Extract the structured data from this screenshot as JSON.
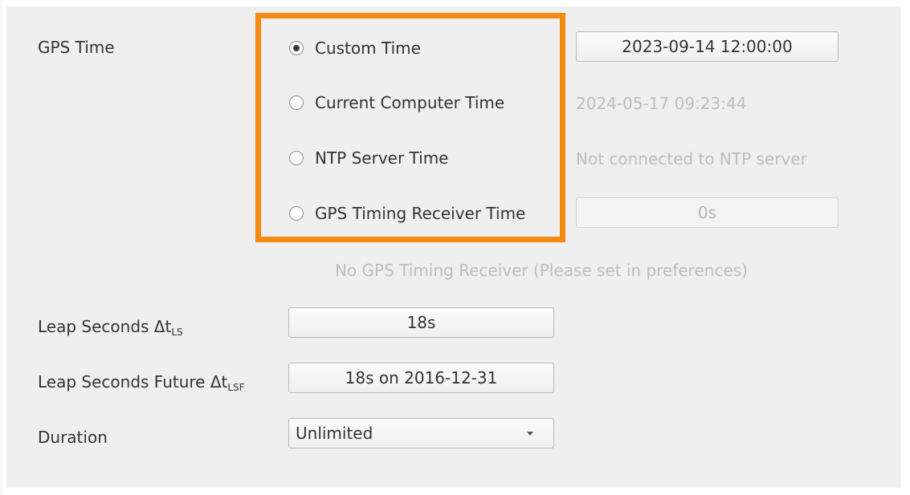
{
  "gps_time": {
    "label": "GPS Time",
    "options": [
      {
        "label": "Custom Time",
        "selected": true,
        "value": "2023-09-14 12:00:00"
      },
      {
        "label": "Current Computer Time",
        "selected": false,
        "value": "2024-05-17 09:23:44"
      },
      {
        "label": "NTP Server Time",
        "selected": false,
        "value": "Not connected to NTP server"
      },
      {
        "label": "GPS Timing Receiver Time",
        "selected": false,
        "value": "0s"
      }
    ],
    "receiver_note": "No GPS Timing Receiver (Please set in preferences)"
  },
  "leap_seconds": {
    "label_text": "Leap Seconds Δt",
    "label_sub": "LS",
    "value": "18s"
  },
  "leap_seconds_future": {
    "label_text": "Leap Seconds Future Δt",
    "label_sub": "LSF",
    "value": "18s on 2016-12-31"
  },
  "duration": {
    "label": "Duration",
    "selected": "Unlimited"
  },
  "colors": {
    "highlight": "#f28a14",
    "accent": "#3a5fa8",
    "panel_bg": "#efefef",
    "disabled_text": "#bdbdbd"
  }
}
